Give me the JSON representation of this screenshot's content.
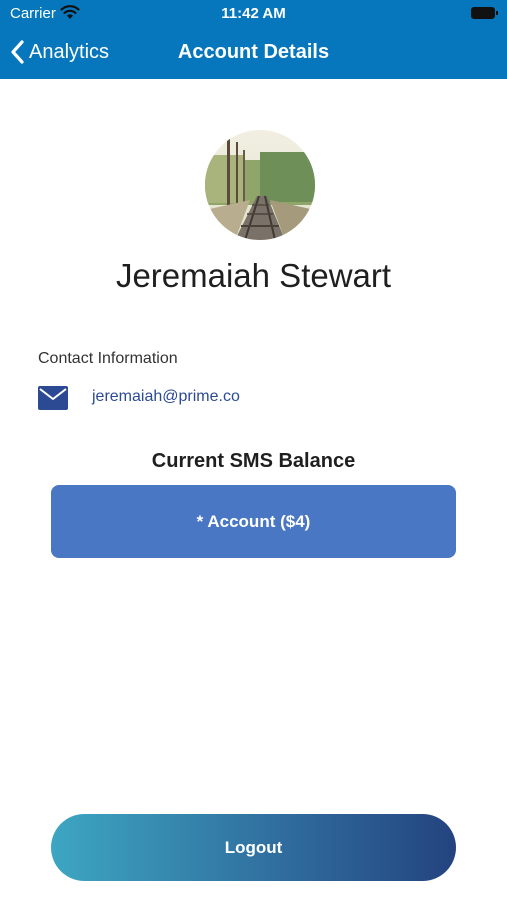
{
  "status_bar": {
    "carrier": "Carrier",
    "time": "11:42 AM"
  },
  "nav": {
    "back_label": "Analytics",
    "title": "Account Details"
  },
  "profile": {
    "name": "Jeremaiah Stewart"
  },
  "contact": {
    "heading": "Contact Information",
    "email": "jeremaiah@prime.co"
  },
  "sms": {
    "heading": "Current SMS Balance",
    "account_button": "* Account ($4)"
  },
  "logout_label": "Logout",
  "colors": {
    "header": "#0677bd",
    "account_button": "#4a77c3",
    "email_link": "#2c4a94",
    "logout_gradient_start": "#3da6c2",
    "logout_gradient_end": "#24437f"
  }
}
